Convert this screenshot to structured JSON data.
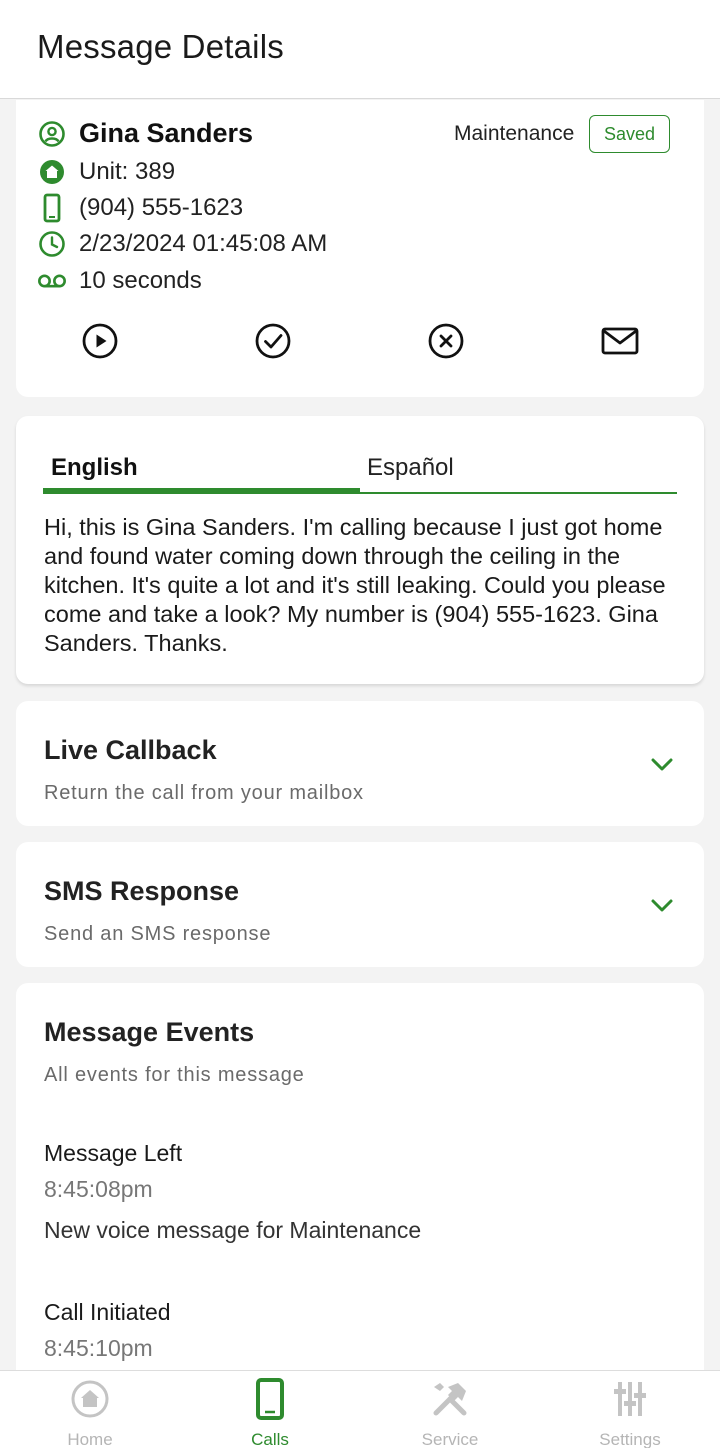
{
  "header": {
    "title": "Message Details"
  },
  "message": {
    "name": "Gina Sanders",
    "unit": "Unit: 389",
    "phone": "(904) 555-1623",
    "datetime": "2/23/2024 01:45:08 AM",
    "duration": "10 seconds",
    "category": "Maintenance",
    "status_badge": "Saved"
  },
  "icons": {
    "name": "user-circle-icon",
    "unit": "home-icon",
    "phone": "mobile-phone-icon",
    "datetime": "clock-icon",
    "duration": "voicemail-icon",
    "actions": [
      "play-icon",
      "check-icon",
      "cancel-icon",
      "mail-icon"
    ]
  },
  "transcript": {
    "tabs": [
      {
        "label": "English",
        "active": true
      },
      {
        "label": "Español",
        "active": false
      }
    ],
    "text": "Hi, this is Gina Sanders. I'm calling because I just got home and found water coming down through the ceiling in the kitchen. It's quite a lot and it's still leaking. Could you please come and take a look? My number is (904) 555-1623. Gina Sanders. Thanks."
  },
  "live_callback": {
    "title": "Live Callback",
    "subtitle": "Return the call from your mailbox"
  },
  "sms_response": {
    "title": "SMS Response",
    "subtitle": "Send an SMS response"
  },
  "events": {
    "title": "Message Events",
    "subtitle": "All events for this message",
    "items": [
      {
        "name": "Message Left",
        "time": "8:45:08pm",
        "description": "New voice message for Maintenance"
      },
      {
        "name": "Call Initiated",
        "time": "8:45:10pm",
        "description": ""
      }
    ]
  },
  "bottom_nav": {
    "items": [
      {
        "label": "Home",
        "icon": "home-icon",
        "active": false
      },
      {
        "label": "Calls",
        "icon": "phone-icon",
        "active": true
      },
      {
        "label": "Service",
        "icon": "tools-icon",
        "active": false
      },
      {
        "label": "Settings",
        "icon": "sliders-icon",
        "active": false
      }
    ]
  },
  "colors": {
    "accent": "#2e8b2e",
    "background": "#f3f3f3",
    "card": "#ffffff",
    "muted": "#6a6a6a"
  }
}
